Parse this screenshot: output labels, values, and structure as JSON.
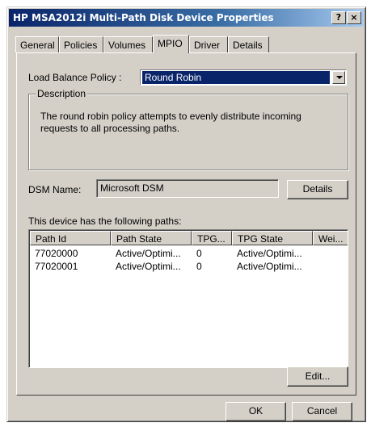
{
  "window": {
    "title": "HP MSA2012i  Multi-Path Disk Device Properties",
    "help_glyph": "?",
    "close_glyph": "×"
  },
  "tabs": [
    {
      "label": "General",
      "active": false
    },
    {
      "label": "Policies",
      "active": false
    },
    {
      "label": "Volumes",
      "active": false
    },
    {
      "label": "MPIO",
      "active": true
    },
    {
      "label": "Driver",
      "active": false
    },
    {
      "label": "Details",
      "active": false
    }
  ],
  "mpio": {
    "load_balance_label": "Load Balance Policy :",
    "load_balance_value": "Round Robin",
    "description_legend": "Description",
    "description_text": "The round robin policy attempts to evenly distribute incoming requests to all processing paths.",
    "dsm_name_label": "DSM Name:",
    "dsm_name_value": "Microsoft DSM",
    "details_button": "Details",
    "paths_caption": "This device has the following paths:",
    "columns": [
      "Path Id",
      "Path State",
      "TPG...",
      "TPG State",
      "Wei..."
    ],
    "rows": [
      [
        "77020000",
        "Active/Optimi...",
        "0",
        "Active/Optimi...",
        ""
      ],
      [
        "77020001",
        "Active/Optimi...",
        "0",
        "Active/Optimi...",
        ""
      ]
    ],
    "edit_button": "Edit..."
  },
  "footer": {
    "ok_button": "OK",
    "cancel_button": "Cancel"
  }
}
